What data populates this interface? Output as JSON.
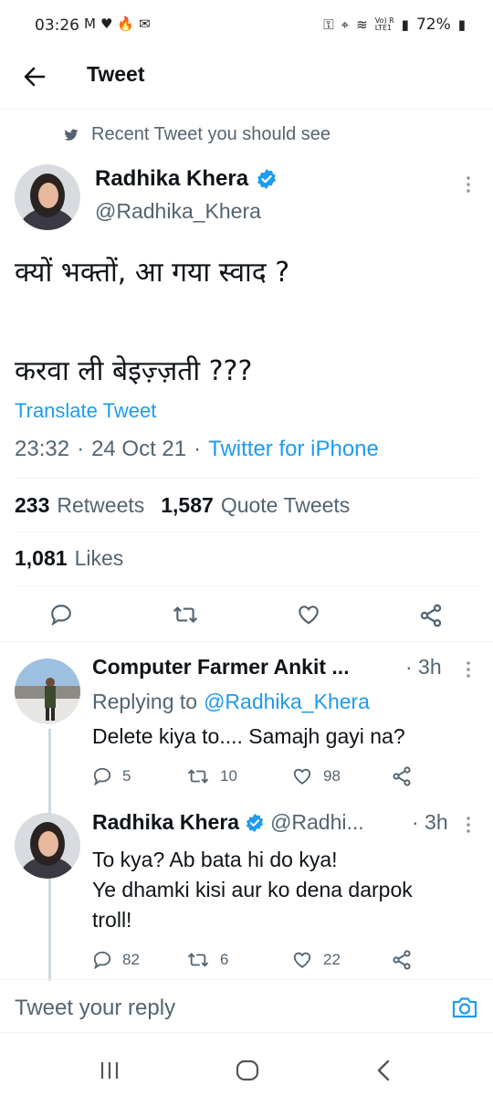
{
  "status_bar": {
    "time": "03:26",
    "battery": "72%",
    "network": "Vo) R\nLTE1"
  },
  "header": {
    "title": "Tweet"
  },
  "context": {
    "label": "Recent Tweet you should see"
  },
  "tweet": {
    "author_name": "Radhika Khera",
    "author_handle": "@Radhika_Khera",
    "text_line1": "क्यों भक्तों, आ गया स्वाद ?",
    "text_line2": "करवा ली बेइज़्ज़ती ???",
    "translate": "Translate Tweet",
    "time": "23:32",
    "date": "24 Oct 21",
    "source": "Twitter for iPhone",
    "retweets_count": "233",
    "retweets_label": "Retweets",
    "quotes_count": "1,587",
    "quotes_label": "Quote Tweets",
    "likes_count": "1,081",
    "likes_label": "Likes"
  },
  "replies": [
    {
      "name": "Computer Farmer Ankit ...",
      "age": "· 3h",
      "replying_prefix": "Replying to",
      "replying_to": "@Radhika_Khera",
      "text": "Delete kiya to.... Samajh gayi na?",
      "reply_count": "5",
      "retweet_count": "10",
      "like_count": "98"
    },
    {
      "name": "Radhika Khera",
      "handle": "@Radhi...",
      "age": "· 3h",
      "text_line1": "To kya? Ab bata hi do kya!",
      "text_line2": "Ye dhamki kisi aur ko dena darpok",
      "text_line3": "troll!",
      "reply_count": "82",
      "retweet_count": "6",
      "like_count": "22"
    }
  ],
  "composer": {
    "placeholder": "Tweet your reply"
  },
  "colors": {
    "accent": "#1d9bf0",
    "text": "#0f1419",
    "secondary": "#536471"
  }
}
